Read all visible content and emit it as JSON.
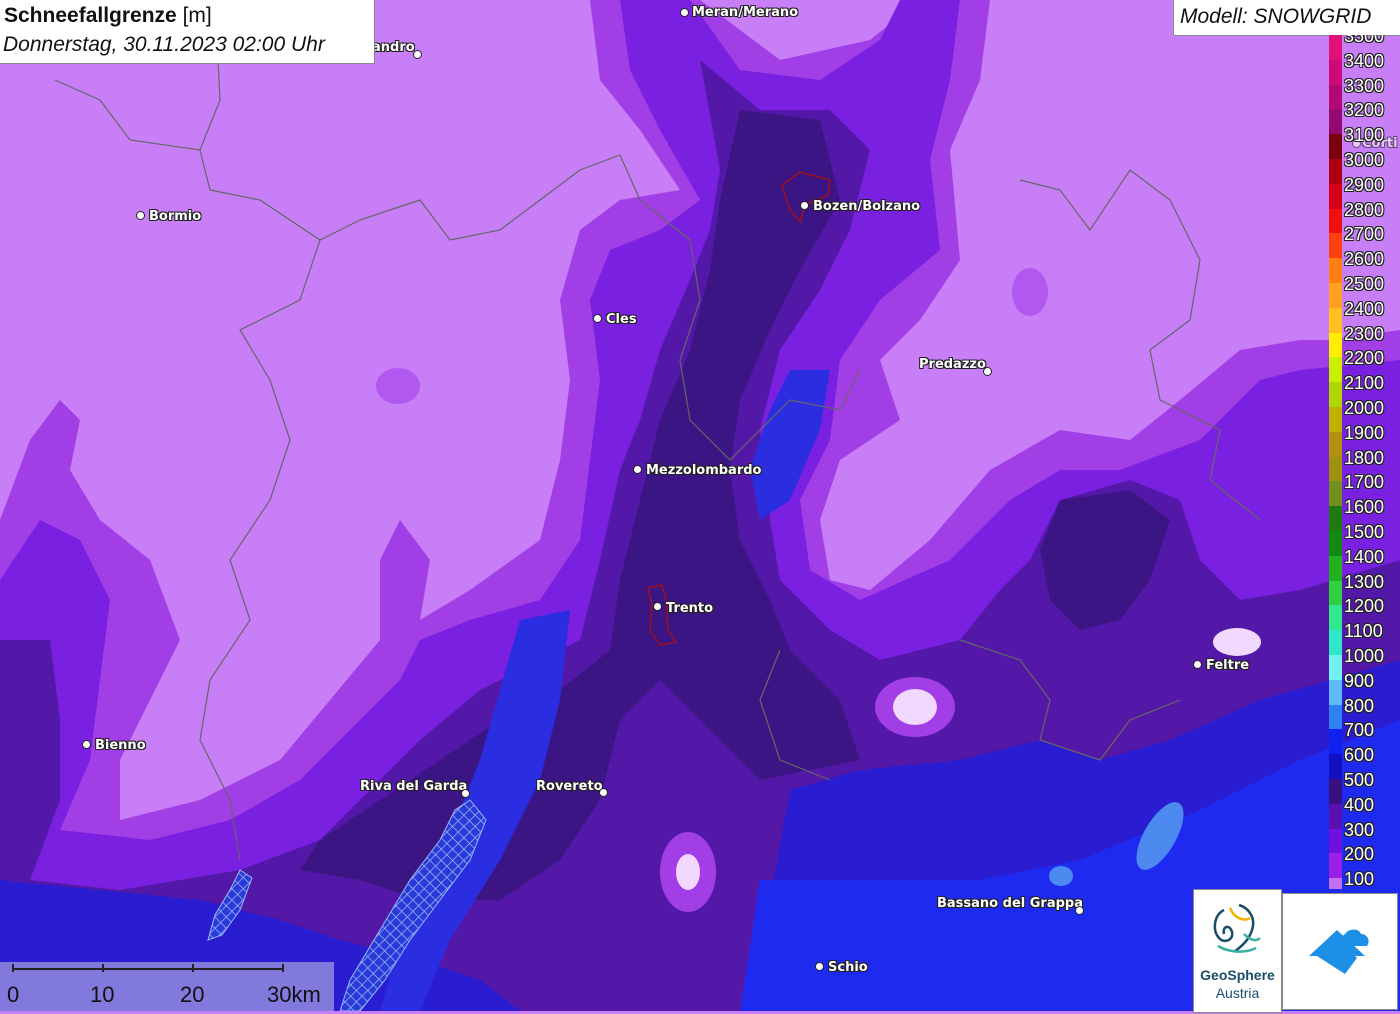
{
  "title": {
    "bold": "Schneefallgrenze",
    "unit": "[m]",
    "date": "Donnerstag, 30.11.2023 02:00 Uhr"
  },
  "model": "Modell: SNOWGRID",
  "legend": [
    {
      "value": "3500",
      "color": "#e0107a"
    },
    {
      "value": "3400",
      "color": "#cc0a78"
    },
    {
      "value": "3300",
      "color": "#b20876"
    },
    {
      "value": "3200",
      "color": "#930a70"
    },
    {
      "value": "3100",
      "color": "#7a0010"
    },
    {
      "value": "3000",
      "color": "#ad0010"
    },
    {
      "value": "2900",
      "color": "#d40018"
    },
    {
      "value": "2800",
      "color": "#f01010"
    },
    {
      "value": "2700",
      "color": "#ff4010"
    },
    {
      "value": "2600",
      "color": "#ff8010"
    },
    {
      "value": "2500",
      "color": "#ffa020"
    },
    {
      "value": "2400",
      "color": "#ffc020"
    },
    {
      "value": "2300",
      "color": "#ffee00"
    },
    {
      "value": "2200",
      "color": "#c8f000"
    },
    {
      "value": "2100",
      "color": "#b0d800"
    },
    {
      "value": "2000",
      "color": "#c0b000"
    },
    {
      "value": "1900",
      "color": "#b49010"
    },
    {
      "value": "1800",
      "color": "#a09010"
    },
    {
      "value": "1700",
      "color": "#709020"
    },
    {
      "value": "1600",
      "color": "#207810"
    },
    {
      "value": "1500",
      "color": "#108a10"
    },
    {
      "value": "1400",
      "color": "#20b020"
    },
    {
      "value": "1300",
      "color": "#30d040"
    },
    {
      "value": "1200",
      "color": "#30e890"
    },
    {
      "value": "1100",
      "color": "#30e8c8"
    },
    {
      "value": "1000",
      "color": "#70f0f0"
    },
    {
      "value": "900",
      "color": "#60b8f8"
    },
    {
      "value": "800",
      "color": "#3080f0"
    },
    {
      "value": "700",
      "color": "#1020f0"
    },
    {
      "value": "600",
      "color": "#1010c0"
    },
    {
      "value": "500",
      "color": "#3a1080"
    },
    {
      "value": "400",
      "color": "#5a10b0"
    },
    {
      "value": "300",
      "color": "#7010e0"
    },
    {
      "value": "200",
      "color": "#9a20e8"
    },
    {
      "value": "100",
      "color": "#c070f0"
    }
  ],
  "cities": [
    {
      "name": "Meran/Merano"
    },
    {
      "name": "andro"
    },
    {
      "name": "Bozen/Bolzano"
    },
    {
      "name": "Bormio"
    },
    {
      "name": "Corti"
    },
    {
      "name": "Cles"
    },
    {
      "name": "Predazzo"
    },
    {
      "name": "Mezzolombardo"
    },
    {
      "name": "Trento"
    },
    {
      "name": "Feltre"
    },
    {
      "name": "Bienno"
    },
    {
      "name": "Riva del Garda"
    },
    {
      "name": "Rovereto"
    },
    {
      "name": "Bassano del Grappa"
    },
    {
      "name": "Schio"
    }
  ],
  "scale": {
    "labels": [
      "0",
      "10",
      "20",
      "30km"
    ]
  },
  "logo": {
    "line1": "GeoSphere",
    "line2": "Austria"
  }
}
